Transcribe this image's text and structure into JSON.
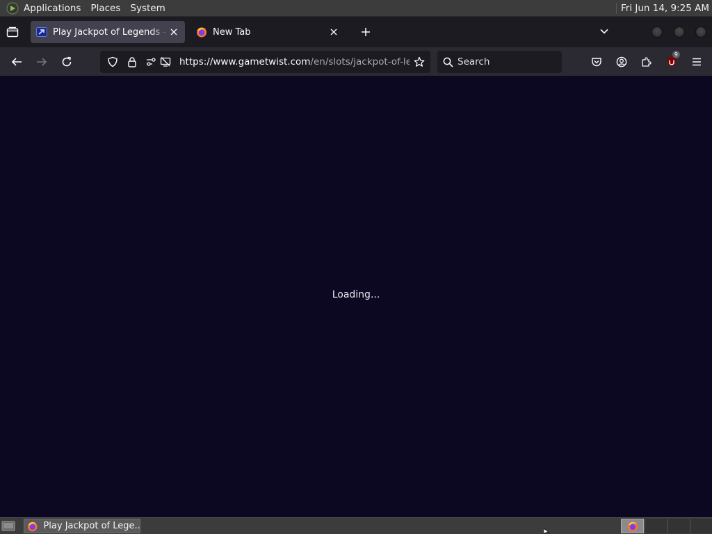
{
  "top_panel": {
    "menus": [
      "Applications",
      "Places",
      "System"
    ],
    "clock": "Fri Jun 14,  9:25 AM"
  },
  "tabs": [
    {
      "title": "Play Jackpot of Legends - Brave",
      "favicon": "gametwist-icon",
      "active": true
    },
    {
      "title": "New Tab",
      "favicon": "firefox-icon",
      "active": false
    }
  ],
  "navbar": {
    "url_host": "https://www.gametwist.com",
    "url_path": "/en/slots/jackpot-of-legends/",
    "search_placeholder": "Search",
    "extension_badge": "9"
  },
  "page": {
    "loading_text": "Loading..."
  },
  "taskbar": {
    "window_label": "Play Jackpot of Lege..."
  },
  "colors": {
    "page_background": "#0c0822",
    "toolbar": "#2b2a33",
    "tabstrip": "#1c1b22",
    "panel": "#3c3c3c"
  }
}
